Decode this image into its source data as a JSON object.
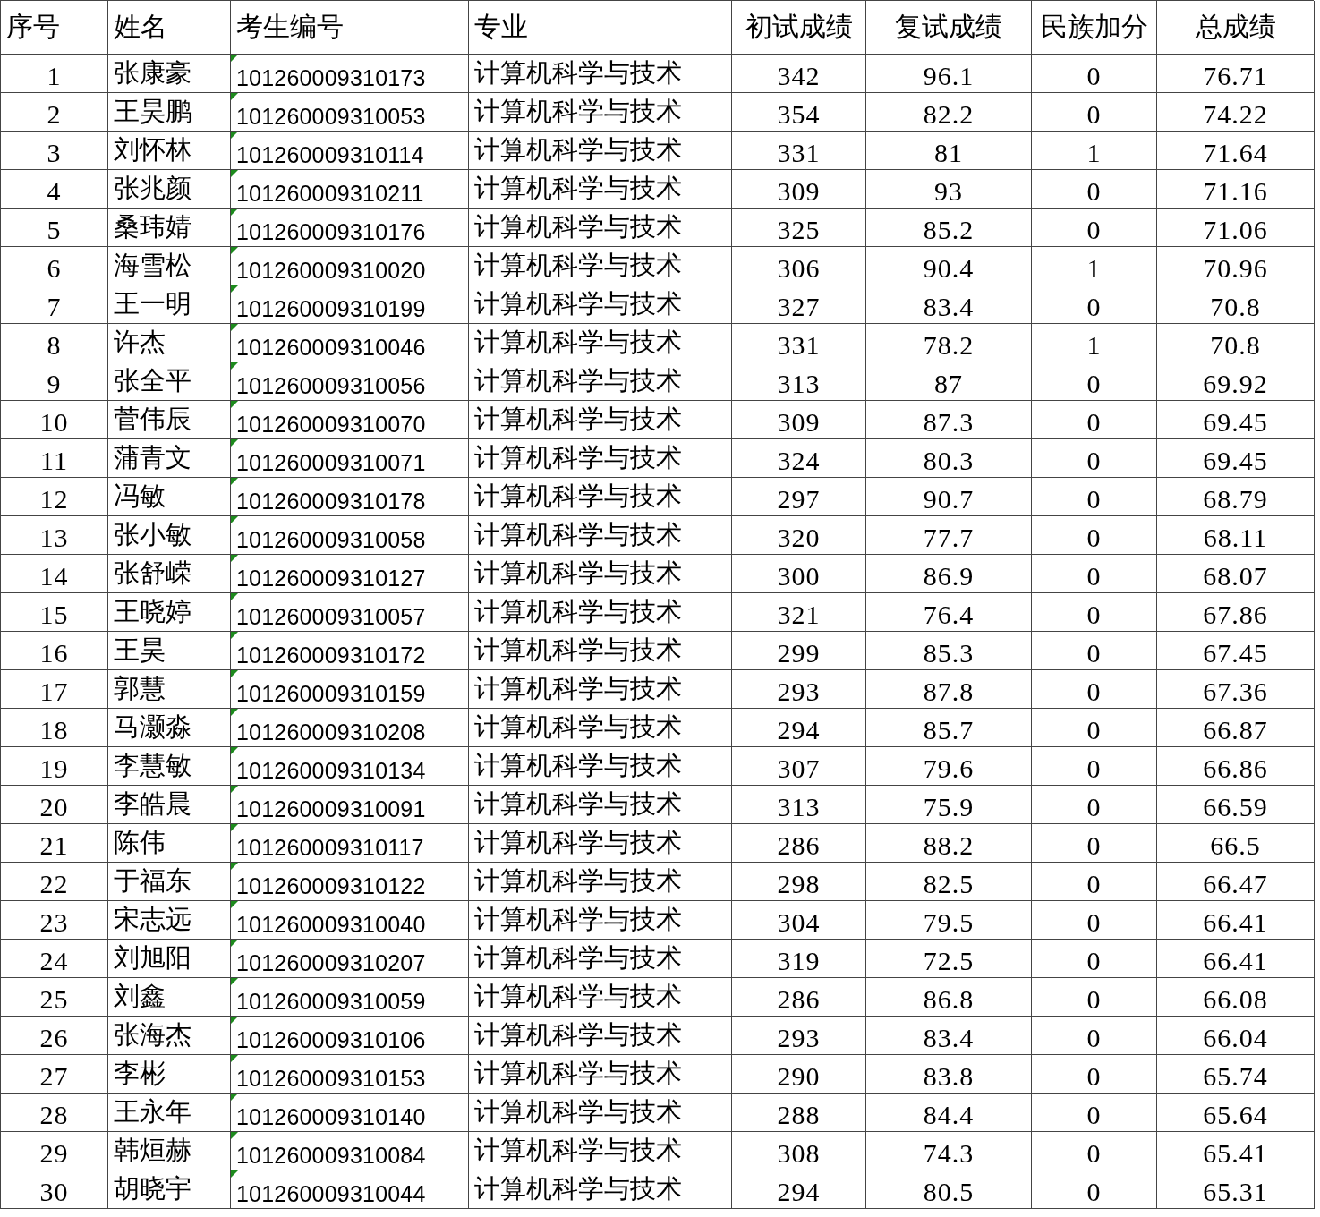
{
  "table": {
    "columns": [
      "序号",
      "姓名",
      "考生编号",
      "专业",
      "初试成绩",
      "复试成绩",
      "民族加分",
      "总成绩"
    ],
    "rows": [
      {
        "cells": [
          "1",
          "张康豪",
          "101260009310173",
          "计算机科学与技术",
          "342",
          "96.1",
          "0",
          "76.71"
        ],
        "flagged": true
      },
      {
        "cells": [
          "2",
          "王昊鹏",
          "101260009310053",
          "计算机科学与技术",
          "354",
          "82.2",
          "0",
          "74.22"
        ],
        "flagged": true
      },
      {
        "cells": [
          "3",
          "刘怀林",
          "101260009310114",
          "计算机科学与技术",
          "331",
          "81",
          "1",
          "71.64"
        ],
        "flagged": true
      },
      {
        "cells": [
          "4",
          "张兆颜",
          "101260009310211",
          "计算机科学与技术",
          "309",
          "93",
          "0",
          "71.16"
        ],
        "flagged": true
      },
      {
        "cells": [
          "5",
          "桑玮婧",
          "101260009310176",
          "计算机科学与技术",
          "325",
          "85.2",
          "0",
          "71.06"
        ],
        "flagged": true
      },
      {
        "cells": [
          "6",
          "海雪松",
          "101260009310020",
          "计算机科学与技术",
          "306",
          "90.4",
          "1",
          "70.96"
        ],
        "flagged": true
      },
      {
        "cells": [
          "7",
          "王一明",
          "101260009310199",
          "计算机科学与技术",
          "327",
          "83.4",
          "0",
          "70.8"
        ],
        "flagged": true
      },
      {
        "cells": [
          "8",
          "许杰",
          "101260009310046",
          "计算机科学与技术",
          "331",
          "78.2",
          "1",
          "70.8"
        ],
        "flagged": true
      },
      {
        "cells": [
          "9",
          "张全平",
          "101260009310056",
          "计算机科学与技术",
          "313",
          "87",
          "0",
          "69.92"
        ],
        "flagged": true
      },
      {
        "cells": [
          "10",
          "菅伟辰",
          "101260009310070",
          "计算机科学与技术",
          "309",
          "87.3",
          "0",
          "69.45"
        ],
        "flagged": true
      },
      {
        "cells": [
          "11",
          "蒲青文",
          "101260009310071",
          "计算机科学与技术",
          "324",
          "80.3",
          "0",
          "69.45"
        ],
        "flagged": true
      },
      {
        "cells": [
          "12",
          "冯敏",
          "101260009310178",
          "计算机科学与技术",
          "297",
          "90.7",
          "0",
          "68.79"
        ],
        "flagged": true
      },
      {
        "cells": [
          "13",
          "张小敏",
          "101260009310058",
          "计算机科学与技术",
          "320",
          "77.7",
          "0",
          "68.11"
        ],
        "flagged": true
      },
      {
        "cells": [
          "14",
          "张舒嵘",
          "101260009310127",
          "计算机科学与技术",
          "300",
          "86.9",
          "0",
          "68.07"
        ],
        "flagged": true
      },
      {
        "cells": [
          "15",
          "王晓婷",
          "101260009310057",
          "计算机科学与技术",
          "321",
          "76.4",
          "0",
          "67.86"
        ],
        "flagged": true
      },
      {
        "cells": [
          "16",
          "王昊",
          "101260009310172",
          "计算机科学与技术",
          "299",
          "85.3",
          "0",
          "67.45"
        ],
        "flagged": true
      },
      {
        "cells": [
          "17",
          "郭慧",
          "101260009310159",
          "计算机科学与技术",
          "293",
          "87.8",
          "0",
          "67.36"
        ],
        "flagged": true
      },
      {
        "cells": [
          "18",
          "马灏淼",
          "101260009310208",
          "计算机科学与技术",
          "294",
          "85.7",
          "0",
          "66.87"
        ],
        "flagged": true
      },
      {
        "cells": [
          "19",
          "李慧敏",
          "101260009310134",
          "计算机科学与技术",
          "307",
          "79.6",
          "0",
          "66.86"
        ],
        "flagged": true
      },
      {
        "cells": [
          "20",
          "李皓晨",
          "101260009310091",
          "计算机科学与技术",
          "313",
          "75.9",
          "0",
          "66.59"
        ],
        "flagged": true
      },
      {
        "cells": [
          "21",
          "陈伟",
          "101260009310117",
          "计算机科学与技术",
          "286",
          "88.2",
          "0",
          "66.5"
        ],
        "flagged": true
      },
      {
        "cells": [
          "22",
          "于福东",
          "101260009310122",
          "计算机科学与技术",
          "298",
          "82.5",
          "0",
          "66.47"
        ],
        "flagged": true
      },
      {
        "cells": [
          "23",
          "宋志远",
          "101260009310040",
          "计算机科学与技术",
          "304",
          "79.5",
          "0",
          "66.41"
        ],
        "flagged": true
      },
      {
        "cells": [
          "24",
          "刘旭阳",
          "101260009310207",
          "计算机科学与技术",
          "319",
          "72.5",
          "0",
          "66.41"
        ],
        "flagged": true
      },
      {
        "cells": [
          "25",
          "刘鑫",
          "101260009310059",
          "计算机科学与技术",
          "286",
          "86.8",
          "0",
          "66.08"
        ],
        "flagged": true
      },
      {
        "cells": [
          "26",
          "张海杰",
          "101260009310106",
          "计算机科学与技术",
          "293",
          "83.4",
          "0",
          "66.04"
        ],
        "flagged": true
      },
      {
        "cells": [
          "27",
          "李彬",
          "101260009310153",
          "计算机科学与技术",
          "290",
          "83.8",
          "0",
          "65.74"
        ],
        "flagged": true
      },
      {
        "cells": [
          "28",
          "王永年",
          "101260009310140",
          "计算机科学与技术",
          "288",
          "84.4",
          "0",
          "65.64"
        ],
        "flagged": true
      },
      {
        "cells": [
          "29",
          "韩烜赫",
          "101260009310084",
          "计算机科学与技术",
          "308",
          "74.3",
          "0",
          "65.41"
        ],
        "flagged": true
      },
      {
        "cells": [
          "30",
          "胡晓宇",
          "101260009310044",
          "计算机科学与技术",
          "294",
          "80.5",
          "0",
          "65.31"
        ],
        "flagged": true
      }
    ]
  }
}
